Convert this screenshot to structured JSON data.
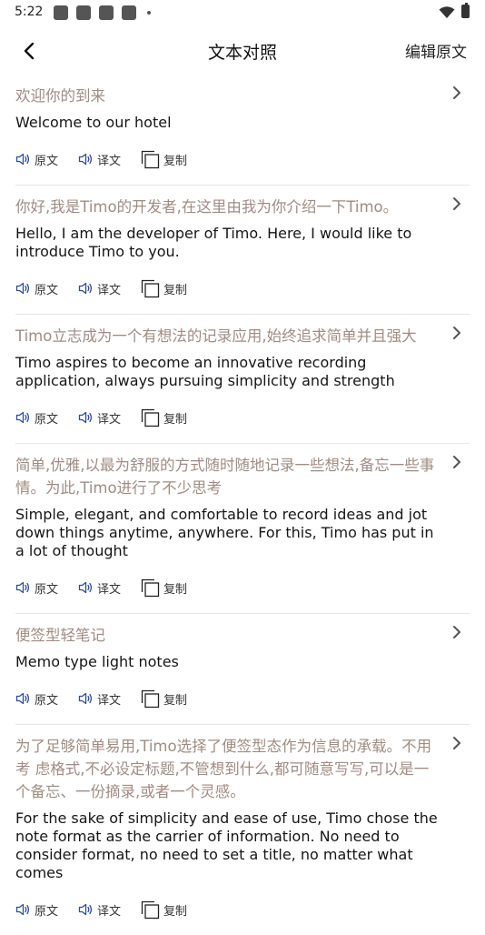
{
  "status_bar": {
    "time": "5:22"
  },
  "header": {
    "title": "文本对照",
    "edit_label": "编辑原文"
  },
  "actions": {
    "original": "原文",
    "translation": "译文",
    "copy": "复制"
  },
  "items": [
    {
      "source": "欢迎你的到来",
      "translation": "Welcome to our hotel"
    },
    {
      "source": "你好,我是Timo的开发者,在这里由我为你介绍一下Timo。",
      "translation": "Hello, I am the developer of Timo. Here, I would like to introduce Timo to you."
    },
    {
      "source": "Timo立志成为一个有想法的记录应用,始终追求简单并且强大",
      "translation": "Timo aspires to become an innovative recording application, always pursuing simplicity and strength"
    },
    {
      "source": "简单,优雅,以最为舒服的方式随时随地记录一些想法,备忘一些事情。为此,Timo进行了不少思考",
      "translation": "Simple, elegant, and comfortable to record ideas and jot down things anytime, anywhere. For this, Timo has put in a lot of thought"
    },
    {
      "source": "便签型轻笔记",
      "translation": "Memo type light notes"
    },
    {
      "source": "为了足够简单易用,Timo选择了便签型态作为信息的承载。不用考 虑格式,不必设定标题,不管想到什么,都可随意写写,可以是一个备忘、一份摘录,或者一个灵感。",
      "translation": "For the sake of simplicity and ease of use, Timo chose the note format as the carrier of information. No need to consider format, no need to set a title, no matter what comes"
    }
  ]
}
